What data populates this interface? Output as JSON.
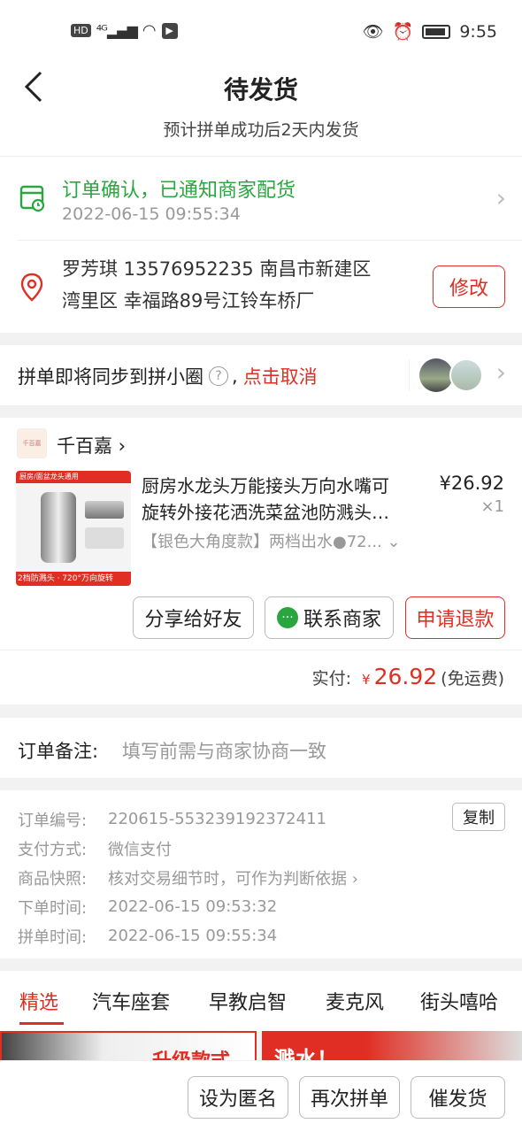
{
  "status": {
    "left": "HD ⁴ᴳ ▂▄▆ ◠ ▶",
    "time": "9:55"
  },
  "header": {
    "title": "待发货",
    "subtitle": "预计拼单成功后2天内发货"
  },
  "order_status": {
    "text": "订单确认，已通知商家配货",
    "time": "2022-06-15 09:55:34"
  },
  "address": {
    "line1": "罗芳琪  13576952235  南昌市新建区",
    "line2": "湾里区 幸福路89号江铃车桥厂",
    "edit": "修改"
  },
  "group": {
    "text": "拼单即将同步到拼小圈",
    "help": "?",
    "cancel": "点击取消"
  },
  "shop": {
    "logo": "千百嘉",
    "name": "千百嘉 ›"
  },
  "product": {
    "name1": "厨房水龙头万能接头万向水嘴可",
    "name2": "旋转外接花洒洗菜盆池防溅头…",
    "price": "¥26.92",
    "qty": "×1",
    "spec": "【银色大角度款】两档出水●72...",
    "img_caption1": "厨房/面盆龙头通用",
    "img_caption2": "2档防溅头 · 720°万向旋转"
  },
  "actions": {
    "share": "分享给好友",
    "contact": "联系商家",
    "refund": "申请退款"
  },
  "pay": {
    "label": "实付:",
    "currency": "¥",
    "amount": "26.92",
    "note": "(免运费)"
  },
  "remark": {
    "label": "订单备注:",
    "placeholder": "填写前需与商家协商一致"
  },
  "info": {
    "copy": "复制",
    "rows": [
      {
        "k": "订单编号:",
        "v": "220615-553239192372411"
      },
      {
        "k": "支付方式:",
        "v": "微信支付"
      },
      {
        "k": "商品快照:",
        "v": "核对交易细节时，可作为判断依据 ›"
      },
      {
        "k": "下单时间:",
        "v": "2022-06-15 09:53:32"
      },
      {
        "k": "拼单时间:",
        "v": "2022-06-15 09:55:34"
      }
    ]
  },
  "tabs": [
    "精选",
    "汽车座套",
    "早教启智",
    "麦克风",
    "街头嘻哈"
  ],
  "promo": {
    "left": "升级款式",
    "right": "溅水！"
  },
  "bottom": {
    "anon": "设为匿名",
    "again": "再次拼单",
    "urge": "催发货"
  },
  "colors": {
    "accent": "#e02e24",
    "green": "#2aa640"
  }
}
